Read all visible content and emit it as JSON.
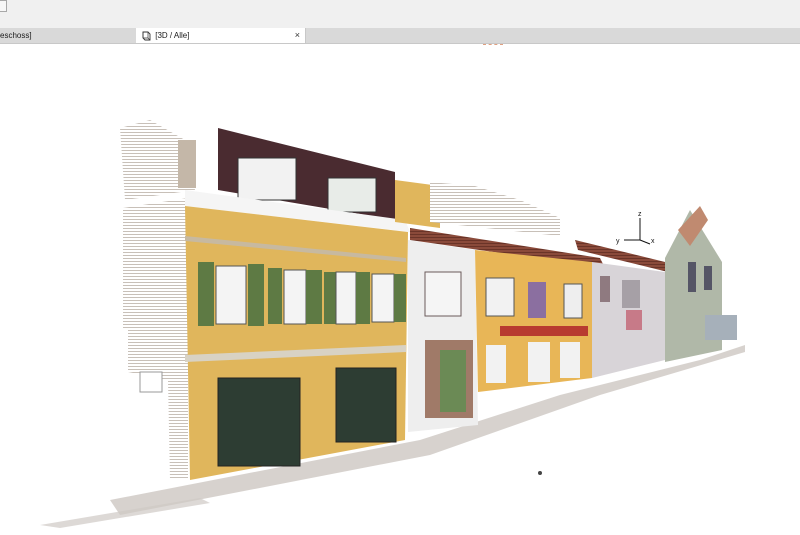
{
  "tabs": [
    {
      "label": "eschoss]"
    },
    {
      "label": "[3D / Alle]",
      "close_glyph": "×"
    }
  ],
  "icons": {
    "view": "3d-view-icon",
    "close": "close-icon"
  },
  "axis": {
    "z": "z",
    "y": "y",
    "x": "x"
  },
  "colors": {
    "toolbar_bg": "#f0f0f0",
    "tabbar_bg": "#d9d9d9",
    "active_tab_bg": "#ffffff",
    "facade_yellow": "#e0b65c",
    "shutter_green": "#5e7a44",
    "roof_dark": "#4a2b30"
  }
}
